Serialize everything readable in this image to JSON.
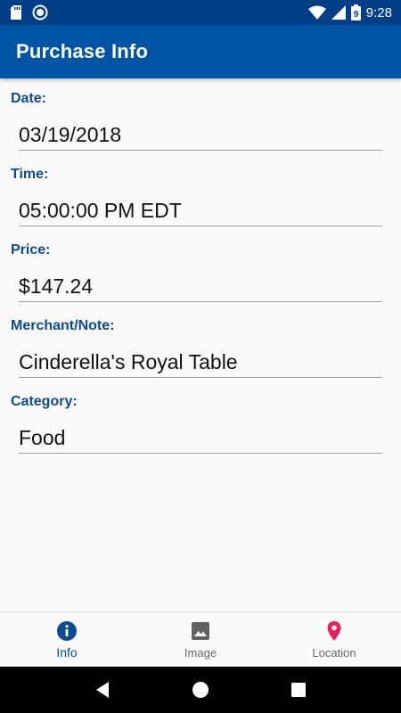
{
  "status_bar": {
    "time": "9:28",
    "battery_level": "9",
    "icons": [
      "sd-card-icon",
      "sync-icon",
      "wifi-icon",
      "signal-icon",
      "battery-icon"
    ]
  },
  "app_bar": {
    "title": "Purchase Info",
    "color": "#0054a6"
  },
  "fields": [
    {
      "label": "Date:",
      "value": "03/19/2018"
    },
    {
      "label": "Time:",
      "value": "05:00:00 PM EDT"
    },
    {
      "label": "Price:",
      "value": "$147.24"
    },
    {
      "label": "Merchant/Note:",
      "value": "Cinderella's Royal Table"
    },
    {
      "label": "Category:",
      "value": "Food"
    }
  ],
  "bottom_nav": {
    "items": [
      {
        "label": "Info",
        "icon": "info-icon",
        "active": true,
        "color": "#0d4a8f"
      },
      {
        "label": "Image",
        "icon": "image-icon",
        "active": false,
        "color": "#616161"
      },
      {
        "label": "Location",
        "icon": "location-pin-icon",
        "active": false,
        "color": "#e91e63"
      }
    ]
  },
  "system_nav": {
    "buttons": [
      "back-icon",
      "home-icon",
      "recents-icon"
    ]
  }
}
